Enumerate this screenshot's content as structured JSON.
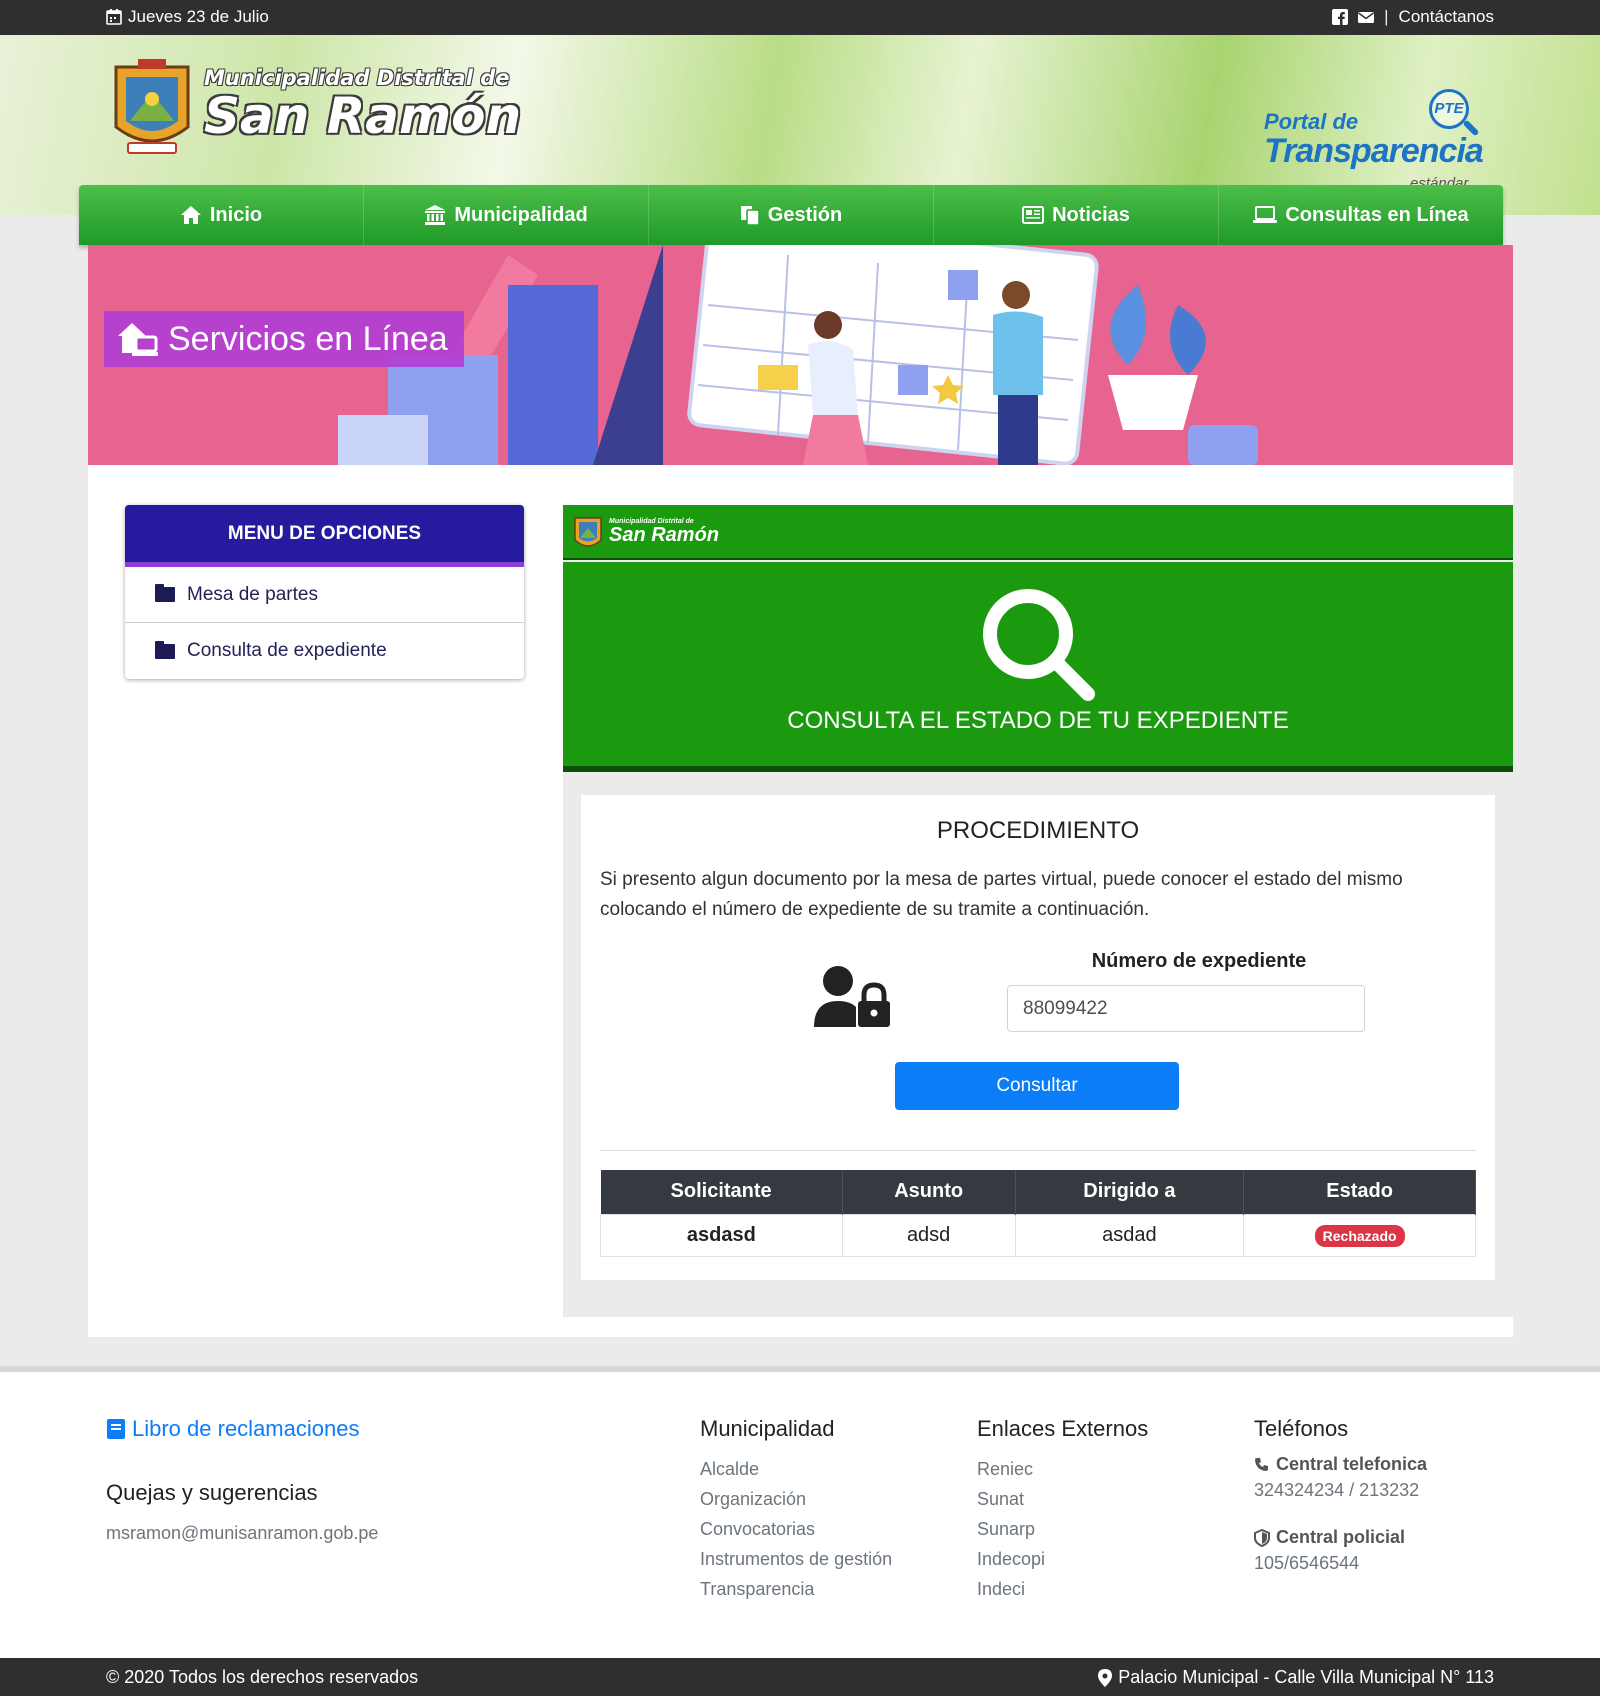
{
  "topbar": {
    "date": "Jueves 23 de Julio",
    "contact": "Contáctanos"
  },
  "header": {
    "logo_line1": "Municipalidad Distrital de",
    "logo_line2": "San Ramón",
    "pte_line1": "Portal de",
    "pte_line2": "Transparencia",
    "pte_line3": "estándar",
    "pte_badge": "PTE"
  },
  "nav": [
    "Inicio",
    "Municipalidad",
    "Gestión",
    "Noticias",
    "Consultas en Línea"
  ],
  "banner": {
    "title": "Servicios en Línea"
  },
  "sidebar": {
    "title": "MENU DE OPCIONES",
    "items": [
      "Mesa de partes",
      "Consulta de expediente"
    ]
  },
  "main": {
    "mini_logo_line1": "Municipalidad Distrital de",
    "mini_logo_line2": "San Ramón",
    "hero_title": "CONSULTA EL ESTADO DE TU EXPEDIENTE",
    "card_title": "PROCEDIMIENTO",
    "card_text": "Si presento algun documento por la mesa de partes virtual, puede conocer el estado del mismo colocando el número de expediente de su tramite a continuación.",
    "input_label": "Número de expediente",
    "input_value": "88099422",
    "button": "Consultar",
    "table": {
      "headers": [
        "Solicitante",
        "Asunto",
        "Dirigido a",
        "Estado"
      ],
      "row": {
        "solicitante": "asdasd",
        "asunto": "adsd",
        "dirigido": "asdad",
        "estado": "Rechazado"
      }
    }
  },
  "footer": {
    "libro": "Libro de reclamaciones",
    "quejas": "Quejas y sugerencias",
    "email": "msramon@munisanramon.gob.pe",
    "municipalidad": {
      "title": "Municipalidad",
      "links": [
        "Alcalde",
        "Organización",
        "Convocatorias",
        "Instrumentos de gestión",
        "Transparencia"
      ]
    },
    "enlaces": {
      "title": "Enlaces Externos",
      "links": [
        "Reniec",
        "Sunat",
        "Sunarp",
        "Indecopi",
        "Indeci"
      ]
    },
    "telefonos": {
      "title": "Teléfonos",
      "central_label": "Central telefonica",
      "central_value": "324324234 / 213232",
      "policial_label": "Central policial",
      "policial_value": "105/6546544"
    },
    "copyright": "© 2020 Todos los derechos reservados",
    "address": "Palacio Municipal - Calle Villa Municipal N° 113"
  },
  "colors": {
    "nav_green": "#1f9a28",
    "hero_green": "#1b9a10",
    "sidebar_head": "#261b9e",
    "banner_pink": "#e6648f",
    "button_blue": "#0b7df6",
    "status_red": "#dc3545"
  }
}
